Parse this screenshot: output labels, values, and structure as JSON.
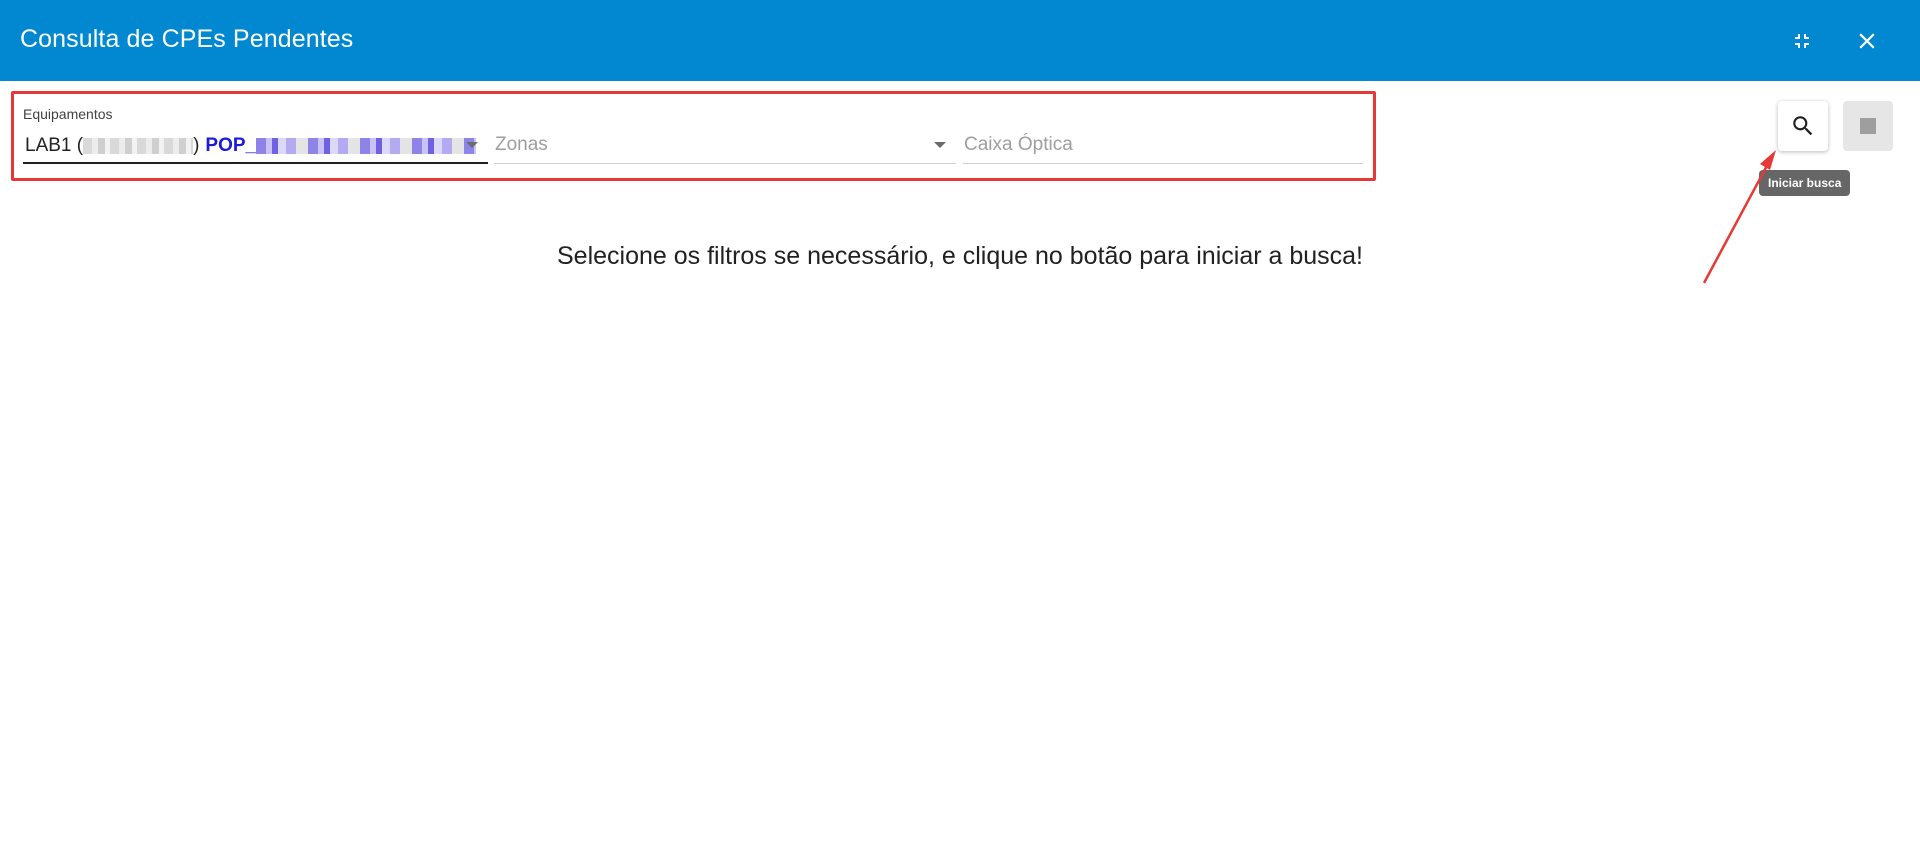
{
  "window": {
    "title": "Consulta de CPEs Pendentes",
    "minimize_icon": "collapse-icon",
    "close_icon": "close-icon"
  },
  "filters": {
    "equipamentos": {
      "label": "Equipamentos",
      "value_prefix": "LAB1 (",
      "value_suffix": ")",
      "pop_label": "POP_"
    },
    "zonas": {
      "placeholder": "Zonas"
    },
    "caixa_optica": {
      "placeholder": "Caixa Óptica"
    }
  },
  "actions": {
    "search_icon": "search-icon",
    "stop_icon": "stop-icon",
    "search_tooltip": "Iniciar busca"
  },
  "main": {
    "message": "Selecione os filtros se necessário, e clique no botão para iniciar a busca!"
  },
  "colors": {
    "titlebar": "#0288d1",
    "highlight": "#e53935",
    "annotation_arrow": "#e53935",
    "pop_text": "#1a1adb"
  }
}
